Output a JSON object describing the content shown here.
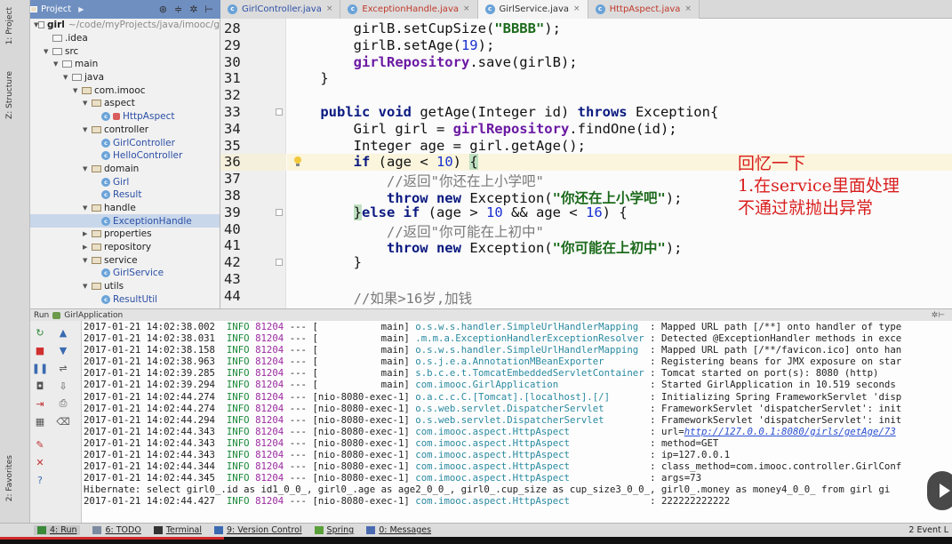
{
  "project_tab": {
    "label": "Project"
  },
  "editor_tabs": [
    {
      "label": "GirlController.java",
      "active": false,
      "color": "#2b4fa5"
    },
    {
      "label": "ExceptionHandle.java",
      "active": false,
      "color": "#c0392b"
    },
    {
      "label": "GirlService.java",
      "active": true,
      "color": "#333333"
    },
    {
      "label": "HttpAspect.java",
      "active": false,
      "color": "#c0392b"
    }
  ],
  "side_labels": {
    "project": "1: Project",
    "structure": "Z: Structure",
    "favorites": "2: Favorites"
  },
  "tree": [
    {
      "label": "girl",
      "extra": "~/code/myProjects/java/imooc/g",
      "depth": 0,
      "kind": "root",
      "arrow": "▼"
    },
    {
      "label": ".idea",
      "depth": 1,
      "kind": "folder",
      "arrow": ""
    },
    {
      "label": "src",
      "depth": 1,
      "kind": "folder",
      "arrow": "▼"
    },
    {
      "label": "main",
      "depth": 2,
      "kind": "folder",
      "arrow": "▼"
    },
    {
      "label": "java",
      "depth": 3,
      "kind": "folder",
      "arrow": "▼"
    },
    {
      "label": "com.imooc",
      "depth": 4,
      "kind": "pkg",
      "arrow": "▼"
    },
    {
      "label": "aspect",
      "depth": 5,
      "kind": "pkg",
      "arrow": "▼"
    },
    {
      "label": "HttpAspect",
      "depth": 6,
      "kind": "aspect",
      "arrow": ""
    },
    {
      "label": "controller",
      "depth": 5,
      "kind": "pkg",
      "arrow": "▼"
    },
    {
      "label": "GirlController",
      "depth": 6,
      "kind": "class",
      "arrow": ""
    },
    {
      "label": "HelloController",
      "depth": 6,
      "kind": "class",
      "arrow": ""
    },
    {
      "label": "domain",
      "depth": 5,
      "kind": "pkg",
      "arrow": "▼"
    },
    {
      "label": "Girl",
      "depth": 6,
      "kind": "class",
      "arrow": ""
    },
    {
      "label": "Result",
      "depth": 6,
      "kind": "class",
      "arrow": ""
    },
    {
      "label": "handle",
      "depth": 5,
      "kind": "pkg",
      "arrow": "▼"
    },
    {
      "label": "ExceptionHandle",
      "depth": 6,
      "kind": "class",
      "arrow": "",
      "selected": true
    },
    {
      "label": "properties",
      "depth": 5,
      "kind": "pkg",
      "arrow": "▶"
    },
    {
      "label": "repository",
      "depth": 5,
      "kind": "pkg",
      "arrow": "▶"
    },
    {
      "label": "service",
      "depth": 5,
      "kind": "pkg",
      "arrow": "▼"
    },
    {
      "label": "GirlService",
      "depth": 6,
      "kind": "class",
      "arrow": ""
    },
    {
      "label": "utils",
      "depth": 5,
      "kind": "pkg",
      "arrow": "▼"
    },
    {
      "label": "ResultUtil",
      "depth": 6,
      "kind": "class",
      "arrow": ""
    }
  ],
  "code": {
    "current_line": 36,
    "lines": [
      {
        "n": "28",
        "tokens": [
          [
            "        girlB.setCupSize(",
            ""
          ],
          [
            "\"BBBB\"",
            "str"
          ],
          [
            ");",
            ""
          ]
        ]
      },
      {
        "n": "29",
        "tokens": [
          [
            "        girlB.setAge(",
            ""
          ],
          [
            "19",
            "num"
          ],
          [
            ");",
            ""
          ]
        ]
      },
      {
        "n": "30",
        "tokens": [
          [
            "        ",
            ""
          ],
          [
            "girlRepository",
            "fld"
          ],
          [
            ".save(girlB);",
            ""
          ]
        ]
      },
      {
        "n": "31",
        "tokens": [
          [
            "    }",
            ""
          ]
        ]
      },
      {
        "n": "32",
        "tokens": [
          [
            "",
            ""
          ]
        ]
      },
      {
        "n": "33",
        "tokens": [
          [
            "    ",
            ""
          ],
          [
            "public void ",
            "kw"
          ],
          [
            "getAge(Integer id) ",
            ""
          ],
          [
            "throws ",
            "kw"
          ],
          [
            "Exception{",
            ""
          ]
        ]
      },
      {
        "n": "34",
        "tokens": [
          [
            "        Girl girl = ",
            ""
          ],
          [
            "girlRepository",
            "fld"
          ],
          [
            ".findOne(id);",
            ""
          ]
        ]
      },
      {
        "n": "35",
        "tokens": [
          [
            "        Integer age = girl.getAge();",
            ""
          ]
        ]
      },
      {
        "n": "36",
        "tokens": [
          [
            "        ",
            ""
          ],
          [
            "if ",
            "kw"
          ],
          [
            "(age < ",
            ""
          ],
          [
            "10",
            "num"
          ],
          [
            ") ",
            ""
          ],
          [
            "{",
            "brace"
          ]
        ]
      },
      {
        "n": "37",
        "tokens": [
          [
            "            //返回\"你还在上小学吧\"",
            "cmt"
          ]
        ]
      },
      {
        "n": "38",
        "tokens": [
          [
            "            ",
            ""
          ],
          [
            "throw new ",
            "kw"
          ],
          [
            "Exception(",
            ""
          ],
          [
            "\"你还在上小学吧\"",
            "str"
          ],
          [
            ");",
            ""
          ]
        ]
      },
      {
        "n": "39",
        "tokens": [
          [
            "        ",
            ""
          ],
          [
            "}",
            "brace"
          ],
          [
            "else if ",
            "kw"
          ],
          [
            "(age > ",
            ""
          ],
          [
            "10",
            "num"
          ],
          [
            " && age < ",
            ""
          ],
          [
            "16",
            "num"
          ],
          [
            ") {",
            ""
          ]
        ]
      },
      {
        "n": "40",
        "tokens": [
          [
            "            //返回\"你可能在上初中\"",
            "cmt"
          ]
        ]
      },
      {
        "n": "41",
        "tokens": [
          [
            "            ",
            ""
          ],
          [
            "throw new ",
            "kw"
          ],
          [
            "Exception(",
            ""
          ],
          [
            "\"你可能在上初中\"",
            "str"
          ],
          [
            ");",
            ""
          ]
        ]
      },
      {
        "n": "42",
        "tokens": [
          [
            "        }",
            ""
          ]
        ]
      },
      {
        "n": "43",
        "tokens": [
          [
            "",
            ""
          ]
        ]
      },
      {
        "n": "44",
        "tokens": [
          [
            "        //如果>16岁,加钱",
            "cmt"
          ]
        ]
      }
    ]
  },
  "annotation": {
    "line1": "回忆一下",
    "line2": "1.在service里面处理",
    "line3": "不通过就抛出异常",
    "color": "#d91e1e"
  },
  "run_panel": {
    "label": "Run",
    "app": "GirlApplication"
  },
  "log_lines": [
    {
      "ts": "2017-01-21 14:02:38.002",
      "lvl": "INFO",
      "pid": "81204",
      "sep": "---",
      "thread": "[           main]",
      "logger": "o.s.w.s.handler.SimpleUrlHandlerMapping ",
      "msg": ": Mapped URL path [/**] onto handler of type"
    },
    {
      "ts": "2017-01-21 14:02:38.031",
      "lvl": "INFO",
      "pid": "81204",
      "sep": "---",
      "thread": "[           main]",
      "logger": ".m.m.a.ExceptionHandlerExceptionResolver",
      "msg": ": Detected @ExceptionHandler methods in exce"
    },
    {
      "ts": "2017-01-21 14:02:38.158",
      "lvl": "INFO",
      "pid": "81204",
      "sep": "---",
      "thread": "[           main]",
      "logger": "o.s.w.s.handler.SimpleUrlHandlerMapping ",
      "msg": ": Mapped URL path [/**/favicon.ico] onto han"
    },
    {
      "ts": "2017-01-21 14:02:38.963",
      "lvl": "INFO",
      "pid": "81204",
      "sep": "---",
      "thread": "[           main]",
      "logger": "o.s.j.e.a.AnnotationMBeanExporter       ",
      "msg": ": Registering beans for JMX exposure on star"
    },
    {
      "ts": "2017-01-21 14:02:39.285",
      "lvl": "INFO",
      "pid": "81204",
      "sep": "---",
      "thread": "[           main]",
      "logger": "s.b.c.e.t.TomcatEmbeddedServletContainer",
      "msg": ": Tomcat started on port(s): 8080 (http)"
    },
    {
      "ts": "2017-01-21 14:02:39.294",
      "lvl": "INFO",
      "pid": "81204",
      "sep": "---",
      "thread": "[           main]",
      "logger": "com.imooc.GirlApplication               ",
      "msg": ": Started GirlApplication in 10.519 seconds"
    },
    {
      "ts": "2017-01-21 14:02:44.274",
      "lvl": "INFO",
      "pid": "81204",
      "sep": "---",
      "thread": "[nio-8080-exec-1]",
      "logger": "o.a.c.c.C.[Tomcat].[localhost].[/]      ",
      "msg": ": Initializing Spring FrameworkServlet 'disp"
    },
    {
      "ts": "2017-01-21 14:02:44.274",
      "lvl": "INFO",
      "pid": "81204",
      "sep": "---",
      "thread": "[nio-8080-exec-1]",
      "logger": "o.s.web.servlet.DispatcherServlet       ",
      "msg": ": FrameworkServlet 'dispatcherServlet': init"
    },
    {
      "ts": "2017-01-21 14:02:44.294",
      "lvl": "INFO",
      "pid": "81204",
      "sep": "---",
      "thread": "[nio-8080-exec-1]",
      "logger": "o.s.web.servlet.DispatcherServlet       ",
      "msg": ": FrameworkServlet 'dispatcherServlet': init"
    },
    {
      "ts": "2017-01-21 14:02:44.343",
      "lvl": "INFO",
      "pid": "81204",
      "sep": "---",
      "thread": "[nio-8080-exec-1]",
      "logger": "com.imooc.aspect.HttpAspect             ",
      "msg": ": url=",
      "link": "http://127.0.0.1:8080/girls/getAge/73"
    },
    {
      "ts": "2017-01-21 14:02:44.343",
      "lvl": "INFO",
      "pid": "81204",
      "sep": "---",
      "thread": "[nio-8080-exec-1]",
      "logger": "com.imooc.aspect.HttpAspect             ",
      "msg": ": method=GET"
    },
    {
      "ts": "2017-01-21 14:02:44.343",
      "lvl": "INFO",
      "pid": "81204",
      "sep": "---",
      "thread": "[nio-8080-exec-1]",
      "logger": "com.imooc.aspect.HttpAspect             ",
      "msg": ": ip=127.0.0.1"
    },
    {
      "ts": "2017-01-21 14:02:44.344",
      "lvl": "INFO",
      "pid": "81204",
      "sep": "---",
      "thread": "[nio-8080-exec-1]",
      "logger": "com.imooc.aspect.HttpAspect             ",
      "msg": ": class_method=com.imooc.controller.GirlConf"
    },
    {
      "ts": "2017-01-21 14:02:44.345",
      "lvl": "INFO",
      "pid": "81204",
      "sep": "---",
      "thread": "[nio-8080-exec-1]",
      "logger": "com.imooc.aspect.HttpAspect             ",
      "msg": ": args=73"
    },
    {
      "plain": "Hibernate: select girl0_.id as id1_0_0_, girl0_.age as age2_0_0_, girl0_.cup_size as cup_size3_0_0_, girl0_.money as money4_0_0_ from girl gi"
    },
    {
      "ts": "2017-01-21 14:02:44.427",
      "lvl": "INFO",
      "pid": "81204",
      "sep": "---",
      "thread": "[nio-8080-exec-1]",
      "logger": "com.imooc.aspect.HttpAspect             ",
      "msg": ": 222222222222"
    }
  ],
  "bottom_tools": [
    {
      "label": "4: Run",
      "active": true,
      "icon_color": "#3a8a3a"
    },
    {
      "label": "6: TODO",
      "active": false,
      "icon_color": "#7a8aa0"
    },
    {
      "label": "Terminal",
      "active": false,
      "icon_color": "#333333"
    },
    {
      "label": "9: Version Control",
      "active": false,
      "icon_color": "#3a6ab0"
    },
    {
      "label": "Spring",
      "active": false,
      "icon_color": "#5aa03a"
    },
    {
      "label": "0: Messages",
      "active": false,
      "icon_color": "#4a6ab0"
    }
  ],
  "event_log": "2 Event L",
  "video": {
    "progress_percent": 23.5
  }
}
